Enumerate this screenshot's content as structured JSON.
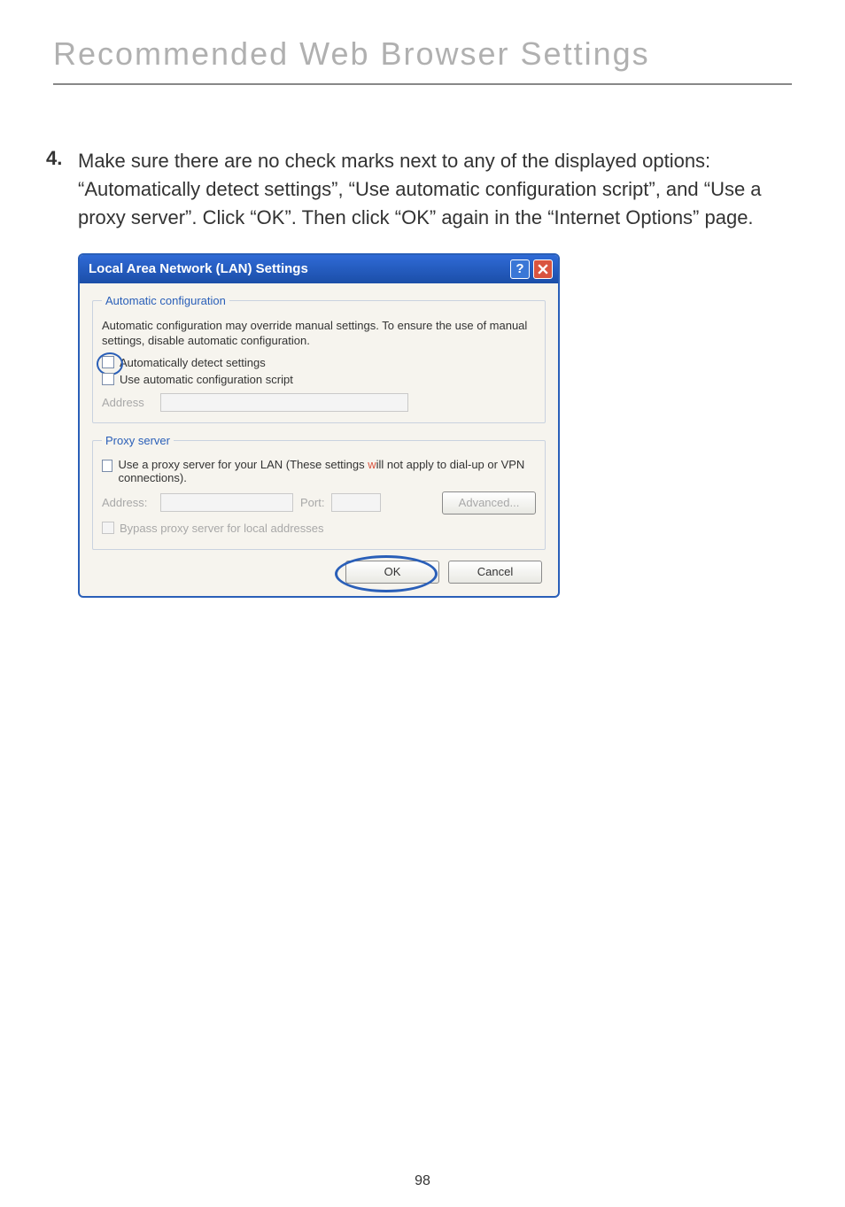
{
  "page": {
    "title": "Recommended Web Browser Settings",
    "number": "98"
  },
  "step": {
    "num": "4.",
    "text": "Make sure there are no check marks next to any of the displayed options: “Automatically detect settings”, “Use automatic configuration script”, and “Use a proxy server”. Click “OK”. Then click “OK” again in the “Internet Options” page."
  },
  "dialog": {
    "title": "Local Area Network (LAN) Settings",
    "help": "?",
    "auto_legend": "Automatic configuration",
    "auto_desc": "Automatic configuration may override manual settings.  To ensure the use of manual settings, disable automatic configuration.",
    "cb_detect": "Automatically detect settings",
    "cb_script": "Use automatic configuration script",
    "address_label": "Address",
    "proxy_legend": "Proxy server",
    "proxy_desc_a": "Use a proxy server for your LAN (These settings ",
    "proxy_desc_w": "w",
    "proxy_desc_b": "ill not apply to dial-up or VPN connections).",
    "address2_label": "Address:",
    "port_label": "Port:",
    "advanced": "Advanced...",
    "cb_bypass": "Bypass proxy server for local addresses",
    "ok": "OK",
    "cancel": "Cancel"
  }
}
